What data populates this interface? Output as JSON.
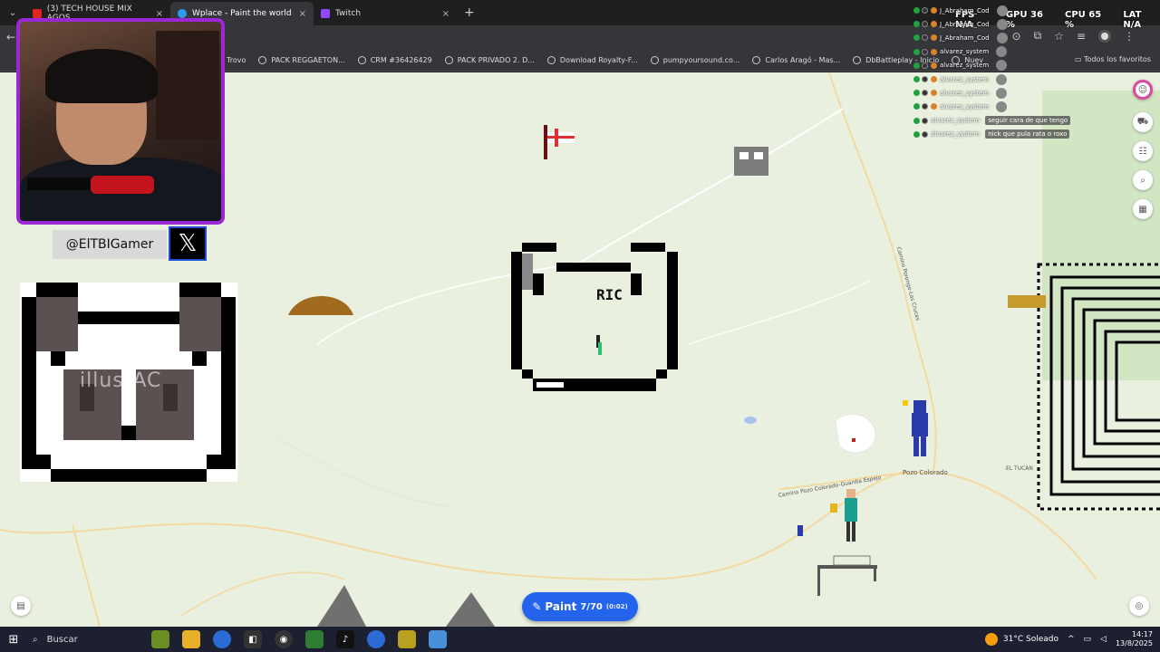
{
  "browser": {
    "tabs": [
      {
        "title": "(3) TECH HOUSE MIX AGOS",
        "favicon_color": "#e02424",
        "active": false
      },
      {
        "title": "Wplace - Paint the world",
        "favicon_color": "#2d9bf0",
        "active": true
      },
      {
        "title": "Twitch",
        "favicon_color": "#9146ff",
        "active": false
      }
    ],
    "bookmarks": [
      "Trovo",
      "PACK REGGAETON...",
      "CRM #36426429",
      "PACK PRIVADO 2. D...",
      "Download Royalty-F...",
      "pumpyoursound.co...",
      "Carlos Aragó - Mas...",
      "DbBattleplay - Inicio",
      "Nuev"
    ],
    "all_bookmarks_label": "Todos los favoritos"
  },
  "map": {
    "canvas_text": "RIC",
    "place_labels": [
      "Pozo Colorado",
      "EL TUCAN",
      "Camino Pozo Colorado-Guardia Espejo",
      "Camino Porongo-Las Cruces"
    ],
    "paint_button": {
      "label": "Paint",
      "count": "7/70",
      "timer": "(0:02)",
      "color": "#2463eb"
    }
  },
  "overlay": {
    "handle": "@ElTBIGamer",
    "x_logo": "𝕏",
    "watermark": "illustAC",
    "stats": [
      {
        "label": "FPS",
        "value": "N/A"
      },
      {
        "label": "GPU",
        "value": "36 %"
      },
      {
        "label": "CPU",
        "value": "65 %"
      },
      {
        "label": "LAT",
        "value": "N/A"
      }
    ],
    "chat": [
      {
        "name": "J_Abraham_Cod",
        "msg": ""
      },
      {
        "name": "J_Abraham_Cod",
        "msg": ""
      },
      {
        "name": "J_Abraham_Cod",
        "msg": ""
      },
      {
        "name": "alvarez_system",
        "msg": ""
      },
      {
        "name": "alvarez_system",
        "msg": ""
      },
      {
        "name": "alvarez_system",
        "msg": ""
      },
      {
        "name": "alvarez_system",
        "msg": ""
      },
      {
        "name": "alvarez_system",
        "msg": ""
      },
      {
        "name": "alvarez_system",
        "msg": "seguir cara de que tengo"
      },
      {
        "name": "alvarez_system",
        "msg": "nick que pula rata o roxo"
      }
    ]
  },
  "taskbar": {
    "search_label": "Buscar",
    "weather": "31°C Soleado",
    "time": "14:17",
    "date": "13/8/2025"
  }
}
